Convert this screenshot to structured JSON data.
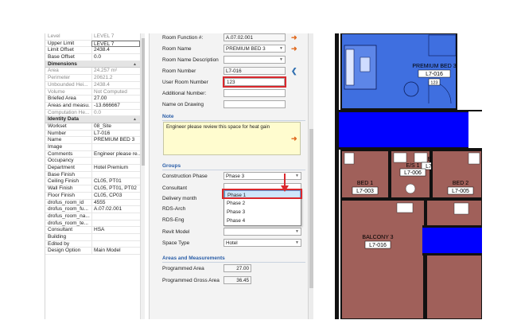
{
  "properties": {
    "rows": [
      {
        "label": "Level",
        "value": "LEVEL 7",
        "dim": true
      },
      {
        "label": "Upper Limit",
        "value": "LEVEL 7",
        "edit": true
      },
      {
        "label": "Limit Offset",
        "value": "2438.4"
      },
      {
        "label": "Base Offset",
        "value": "0.0"
      },
      {
        "section": "Dimensions"
      },
      {
        "label": "Area",
        "value": "24.257 m²",
        "dim": true
      },
      {
        "label": "Perimeter",
        "value": "20621.2",
        "dim": true
      },
      {
        "label": "Unbounded Hei...",
        "value": "2438.4",
        "dim": true
      },
      {
        "label": "Volume",
        "value": "Not Computed",
        "dim": true
      },
      {
        "label": "Briefed Area",
        "value": "27.00"
      },
      {
        "label": "Areas and measu...",
        "value": "-13.666667"
      },
      {
        "label": "Computation He...",
        "value": "0.0",
        "dim": true
      },
      {
        "section": "Identity Data"
      },
      {
        "label": "Workset",
        "value": "08_Site"
      },
      {
        "label": "Number",
        "value": "L7-016"
      },
      {
        "label": "Name",
        "value": "PREMIUM BED 3"
      },
      {
        "label": "Image",
        "value": ""
      },
      {
        "label": "Comments",
        "value": "Engineer please re..."
      },
      {
        "label": "Occupancy",
        "value": ""
      },
      {
        "label": "Department",
        "value": "Hotel Premium"
      },
      {
        "label": "Base Finish",
        "value": ""
      },
      {
        "label": "Ceiling Finish",
        "value": "CL05, PT01"
      },
      {
        "label": "Wall Finish",
        "value": "CL05, PT01, PT02"
      },
      {
        "label": "Floor Finish",
        "value": "CL05, CP03"
      },
      {
        "label": "drofus_room_id",
        "value": "4555"
      },
      {
        "label": "drofus_room_fu...",
        "value": "A.07.02.001"
      },
      {
        "label": "drofus_room_na...",
        "value": ""
      },
      {
        "label": "drofus_room_te...",
        "value": ""
      },
      {
        "label": "Consultant",
        "value": "HSA"
      },
      {
        "label": "Building",
        "value": ""
      },
      {
        "label": "Edited by",
        "value": ""
      },
      {
        "label": "Design Option",
        "value": "Main Model"
      }
    ]
  },
  "form": {
    "room_function_label": "Room Function #:",
    "room_function_value": "A.07.02.001",
    "room_name_label": "Room Name",
    "room_name_value": "PREMIUM BED 3",
    "room_name_desc_label": "Room Name Description",
    "room_number_label": "Room Number",
    "room_number_value": "L7-016",
    "user_room_number_label": "User Room Number",
    "user_room_number_value": "123",
    "additional_number_label": "Additional Number:",
    "name_on_drawing_label": "Name on Drawing",
    "note_header": "Note",
    "note_text": "Engineer please review this space for heat gain",
    "groups_header": "Groups",
    "construction_phase_label": "Construction Phase",
    "construction_phase_value": "Phase 3",
    "consultant_label": "Consultant",
    "delivery_month_label": "Delivery month",
    "rds_arch_label": "RDS-Arch",
    "rds_eng_label": "RDS-Eng",
    "revit_model_label": "Revit Model",
    "space_type_label": "Space Type",
    "space_type_value": "Hotel",
    "areas_header": "Areas and Measurements",
    "programmed_area_label": "Programmed Area",
    "programmed_area_value": "27.00",
    "programmed_gross_label": "Programmed Gross Area",
    "programmed_gross_value": "36.45",
    "phase_options": [
      "Phase 1",
      "Phase 2",
      "Phase 3",
      "Phase 4"
    ]
  },
  "plan": {
    "premium_room_name": "PREMIUM BED 3",
    "premium_room_number": "L7-016",
    "premium_area_tag": "123",
    "es_label": "E/S 2",
    "es_number": "L7-006",
    "es1_label": "E/S 1",
    "es1_number": "L7-006",
    "bed1_name": "BED 1",
    "bed1_number": "L7-003",
    "bed2_name": "BED 2",
    "bed2_number": "L7-005",
    "balcony_name": "BALCONY 3",
    "balcony_number": "L7-016"
  },
  "colors": {
    "selected_room": "#3f6fe0",
    "corridor": "#0000ff",
    "room_fill": "#a0605a",
    "accent_orange": "#e06a1f",
    "highlight_red": "#d9282d"
  }
}
